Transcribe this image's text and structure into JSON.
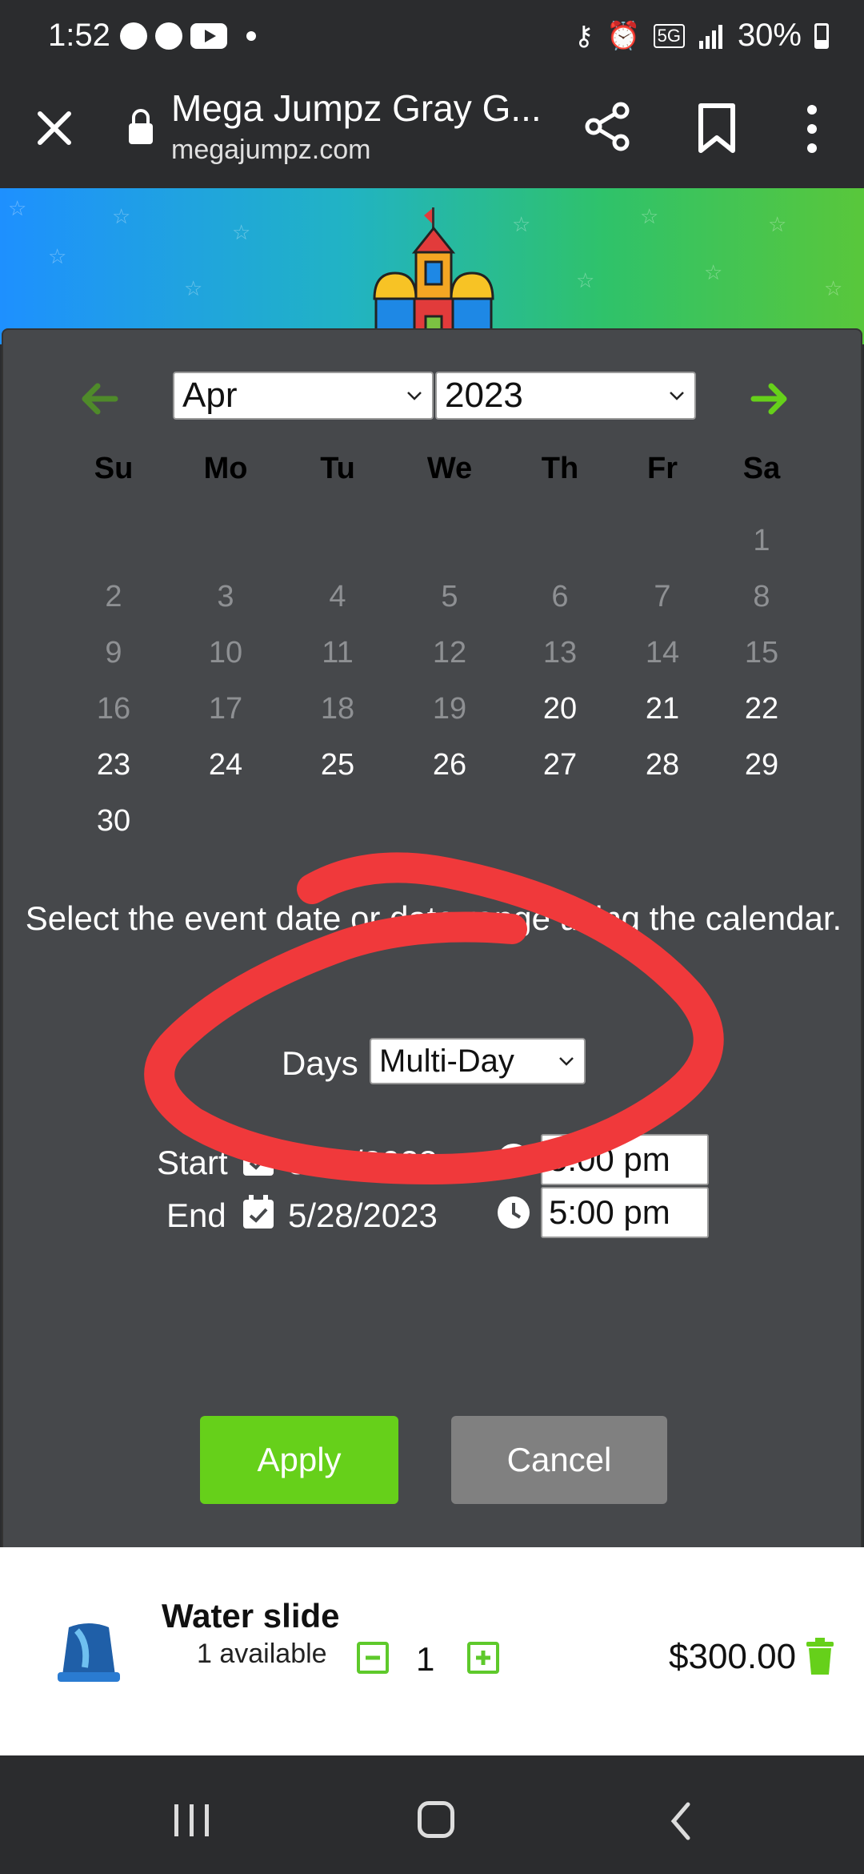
{
  "status_bar": {
    "time": "1:52",
    "battery": "30%",
    "network": "5G"
  },
  "browser": {
    "title": "Mega Jumpz Gray G...",
    "url": "megajumpz.com"
  },
  "calendar": {
    "month": "Apr",
    "year": "2023",
    "weekdays": [
      "Su",
      "Mo",
      "Tu",
      "We",
      "Th",
      "Fr",
      "Sa"
    ],
    "weeks": [
      [
        "",
        "",
        "",
        "",
        "",
        "",
        "1"
      ],
      [
        "2",
        "3",
        "4",
        "5",
        "6",
        "7",
        "8"
      ],
      [
        "9",
        "10",
        "11",
        "12",
        "13",
        "14",
        "15"
      ],
      [
        "16",
        "17",
        "18",
        "19",
        "20",
        "21",
        "22"
      ],
      [
        "23",
        "24",
        "25",
        "26",
        "27",
        "28",
        "29"
      ],
      [
        "30",
        "",
        "",
        "",
        "",
        "",
        ""
      ]
    ],
    "first_available_day": 20
  },
  "event": {
    "instruction": "Select the event date or date range using the calendar.",
    "days_label": "Days",
    "days_value": "Multi-Day",
    "start_label": "Start",
    "start_date": "5/27/2023",
    "start_time": "5:00 pm",
    "end_label": "End",
    "end_date": "5/28/2023",
    "end_time": "5:00 pm"
  },
  "buttons": {
    "apply": "Apply",
    "cancel": "Cancel"
  },
  "cart_item": {
    "name": "Water slide",
    "availability": "1 available",
    "quantity": "1",
    "price": "$300.00"
  },
  "colors": {
    "accent_green": "#66d01a",
    "cancel_gray": "#808080",
    "modal_bg": "#46484b",
    "annotation_red": "#f0393b"
  }
}
